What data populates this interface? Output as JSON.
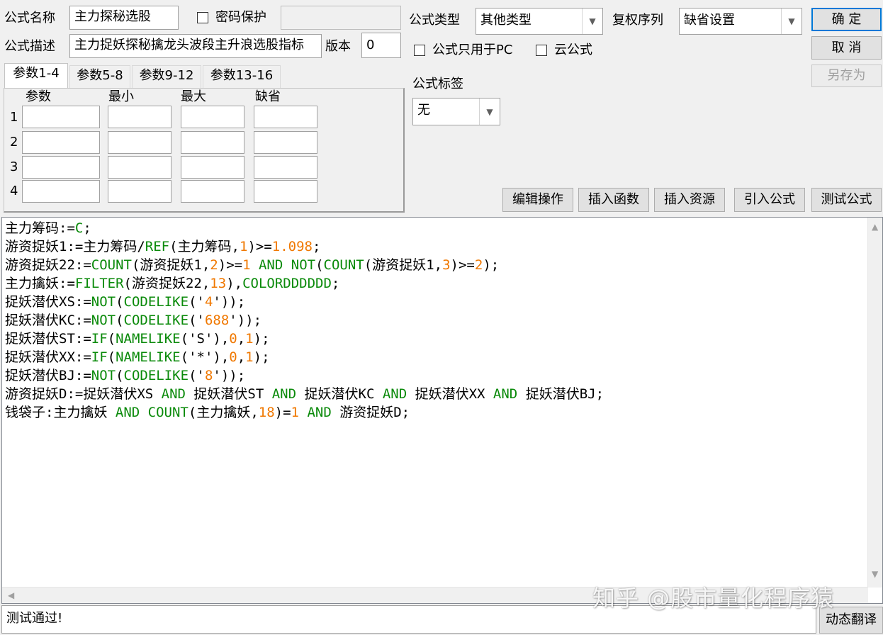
{
  "form": {
    "name_label": "公式名称",
    "name_value": "主力探秘选股",
    "password_label": "密码保护",
    "password_value": "",
    "desc_label": "公式描述",
    "desc_value": "主力捉妖探秘擒龙头波段主升浪选股指标",
    "version_label": "版本",
    "version_value": "0",
    "type_label": "公式类型",
    "type_value": "其他类型",
    "rights_label": "复权序列",
    "rights_value": "缺省设置",
    "pc_only_label": "公式只用于PC",
    "cloud_label": "云公式",
    "tag_label": "公式标签",
    "tag_value": "无"
  },
  "buttons": {
    "ok": "确 定",
    "cancel": "取 消",
    "save_as": "另存为",
    "edit_op": "编辑操作",
    "insert_func": "插入函数",
    "insert_res": "插入资源",
    "import_formula": "引入公式",
    "test_formula": "测试公式",
    "dynamic_translate": "动态翻译"
  },
  "tabs": [
    "参数1-4",
    "参数5-8",
    "参数9-12",
    "参数13-16"
  ],
  "params": {
    "headers": [
      "参数",
      "最小",
      "最大",
      "缺省"
    ],
    "rows": [
      "1",
      "2",
      "3",
      "4"
    ]
  },
  "code_lines": [
    [
      [
        "t",
        "主力筹码:="
      ],
      [
        "k",
        "C"
      ],
      [
        "t",
        ";"
      ]
    ],
    [
      [
        "t",
        "游资捉妖1:=主力筹码/"
      ],
      [
        "k",
        "REF"
      ],
      [
        "t",
        "(主力筹码,"
      ],
      [
        "n",
        "1"
      ],
      [
        "t",
        ")>="
      ],
      [
        "n",
        "1.098"
      ],
      [
        "t",
        ";"
      ]
    ],
    [
      [
        "t",
        "游资捉妖22:="
      ],
      [
        "k",
        "COUNT"
      ],
      [
        "t",
        "(游资捉妖1,"
      ],
      [
        "n",
        "2"
      ],
      [
        "t",
        ")>="
      ],
      [
        "n",
        "1"
      ],
      [
        "t",
        " "
      ],
      [
        "k",
        "AND"
      ],
      [
        "t",
        " "
      ],
      [
        "k",
        "NOT"
      ],
      [
        "t",
        "("
      ],
      [
        "k",
        "COUNT"
      ],
      [
        "t",
        "(游资捉妖1,"
      ],
      [
        "n",
        "3"
      ],
      [
        "t",
        ")>="
      ],
      [
        "n",
        "2"
      ],
      [
        "t",
        ");"
      ]
    ],
    [
      [
        "t",
        "主力擒妖:="
      ],
      [
        "k",
        "FILTER"
      ],
      [
        "t",
        "(游资捉妖22,"
      ],
      [
        "n",
        "13"
      ],
      [
        "t",
        "),"
      ],
      [
        "k",
        "COLORDDDDDD"
      ],
      [
        "t",
        ";"
      ]
    ],
    [
      [
        "t",
        "捉妖潜伏XS:="
      ],
      [
        "k",
        "NOT"
      ],
      [
        "t",
        "("
      ],
      [
        "k",
        "CODELIKE"
      ],
      [
        "t",
        "('"
      ],
      [
        "n",
        "4"
      ],
      [
        "t",
        "'));"
      ]
    ],
    [
      [
        "t",
        "捉妖潜伏KC:="
      ],
      [
        "k",
        "NOT"
      ],
      [
        "t",
        "("
      ],
      [
        "k",
        "CODELIKE"
      ],
      [
        "t",
        "('"
      ],
      [
        "n",
        "688"
      ],
      [
        "t",
        "'));"
      ]
    ],
    [
      [
        "t",
        "捉妖潜伏ST:="
      ],
      [
        "k",
        "IF"
      ],
      [
        "t",
        "("
      ],
      [
        "k",
        "NAMELIKE"
      ],
      [
        "t",
        "('S'),"
      ],
      [
        "n",
        "0"
      ],
      [
        "t",
        ","
      ],
      [
        "n",
        "1"
      ],
      [
        "t",
        ");"
      ]
    ],
    [
      [
        "t",
        "捉妖潜伏XX:="
      ],
      [
        "k",
        "IF"
      ],
      [
        "t",
        "("
      ],
      [
        "k",
        "NAMELIKE"
      ],
      [
        "t",
        "('*'),"
      ],
      [
        "n",
        "0"
      ],
      [
        "t",
        ","
      ],
      [
        "n",
        "1"
      ],
      [
        "t",
        ");"
      ]
    ],
    [
      [
        "t",
        "捉妖潜伏BJ:="
      ],
      [
        "k",
        "NOT"
      ],
      [
        "t",
        "("
      ],
      [
        "k",
        "CODELIKE"
      ],
      [
        "t",
        "('"
      ],
      [
        "n",
        "8"
      ],
      [
        "t",
        "'));"
      ]
    ],
    [
      [
        "t",
        "游资捉妖D:=捉妖潜伏XS "
      ],
      [
        "k",
        "AND"
      ],
      [
        "t",
        " 捉妖潜伏ST "
      ],
      [
        "k",
        "AND"
      ],
      [
        "t",
        " 捉妖潜伏KC "
      ],
      [
        "k",
        "AND"
      ],
      [
        "t",
        " 捉妖潜伏XX "
      ],
      [
        "k",
        "AND"
      ],
      [
        "t",
        " 捉妖潜伏BJ;"
      ]
    ],
    [
      [
        "t",
        "钱袋子:主力擒妖 "
      ],
      [
        "k",
        "AND"
      ],
      [
        "t",
        " "
      ],
      [
        "k",
        "COUNT"
      ],
      [
        "t",
        "(主力擒妖,"
      ],
      [
        "n",
        "18"
      ],
      [
        "t",
        ")="
      ],
      [
        "n",
        "1"
      ],
      [
        "t",
        " "
      ],
      [
        "k",
        "AND"
      ],
      [
        "t",
        " 游资捉妖D;"
      ]
    ]
  ],
  "status_text": "测试通过!",
  "watermark": "知乎 @股市量化程序猿",
  "colors": {
    "keyword": "#0a8a0a",
    "number": "#f07800",
    "background": "#f0f0f0"
  }
}
